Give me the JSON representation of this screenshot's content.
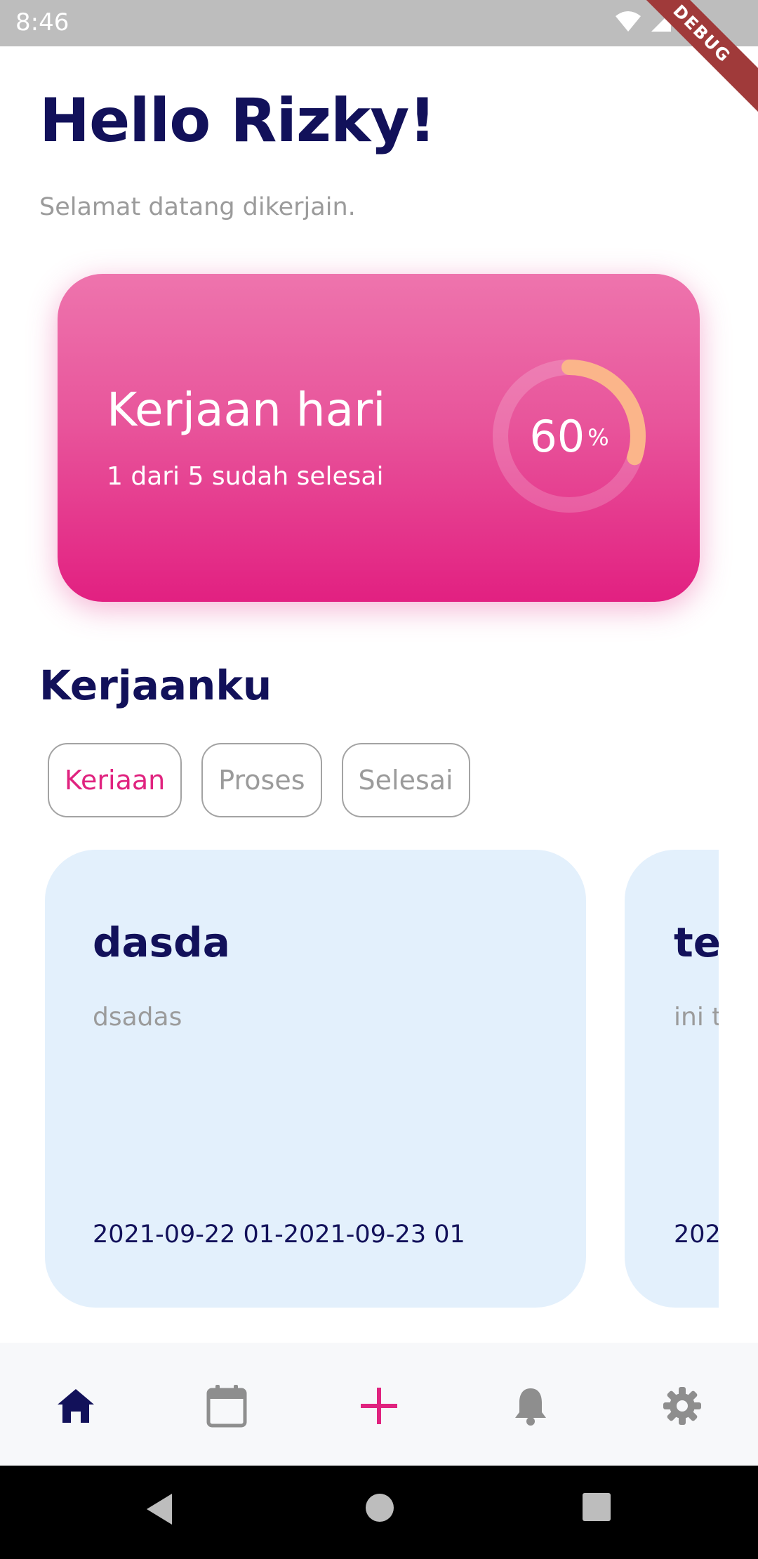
{
  "status_bar": {
    "time": "8:46",
    "debug_label": "DEBUG"
  },
  "greeting": "Hello Rizky!",
  "subtitle": "Selamat datang dikerjain.",
  "summary_card": {
    "title": "Kerjaan hari",
    "subtitle": "1 dari 5 sudah selesai",
    "progress_value": "60",
    "progress_unit": "%",
    "progress_fraction": 0.6,
    "colors": {
      "top": "#ee74ad",
      "bottom": "#e22081",
      "ring_start": "#f8a88a",
      "ring_end": "#fbb98a"
    }
  },
  "section_title": "Kerjaanku",
  "filters": [
    {
      "label": "Keriaan",
      "active": true
    },
    {
      "label": "Proses",
      "active": false
    },
    {
      "label": "Selesai",
      "active": false
    }
  ],
  "tasks": [
    {
      "title": "dasda",
      "description": "dsadas",
      "date_range": "2021-09-22 01-2021-09-23 01"
    },
    {
      "title": "tes",
      "description": "ini t",
      "date_range": "202"
    }
  ],
  "bottom_nav": [
    {
      "icon": "home-icon",
      "active": true
    },
    {
      "icon": "calendar-icon",
      "active": false
    },
    {
      "icon": "add-icon",
      "active": false
    },
    {
      "icon": "bell-icon",
      "active": false
    },
    {
      "icon": "settings-icon",
      "active": false
    }
  ],
  "colors": {
    "primary_text": "#12115a",
    "accent": "#e0237f",
    "muted": "#9b9b9b",
    "card_bg": "#e3f0fc"
  }
}
